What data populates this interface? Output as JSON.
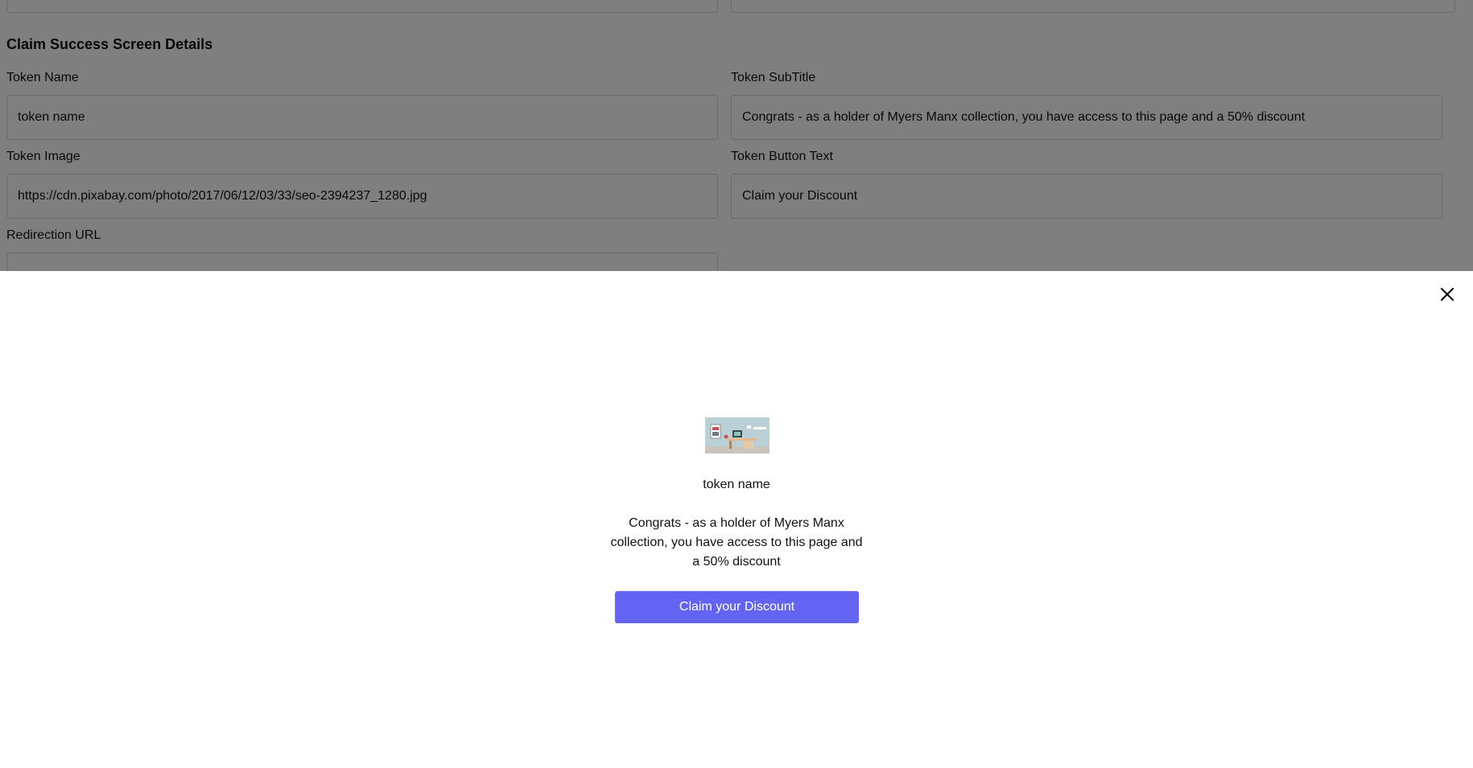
{
  "form": {
    "section_title": "Claim Success Screen Details",
    "token_name_label": "Token Name",
    "token_name_value": "token name",
    "token_subtitle_label": "Token SubTitle",
    "token_subtitle_value": "Congrats - as a holder of Myers Manx collection, you have access to this page and a 50% discount",
    "token_image_label": "Token Image",
    "token_image_value": "https://cdn.pixabay.com/photo/2017/06/12/03/33/seo-2394237_1280.jpg",
    "token_button_text_label": "Token Button Text",
    "token_button_text_value": "Claim your Discount",
    "redirection_url_label": "Redirection URL"
  },
  "modal": {
    "close_icon": "close-icon",
    "token_name": "token name",
    "token_subtitle": "Congrats - as a holder of Myers Manx collection, you have access to this page and a 50% discount",
    "button_label": "Claim your Discount",
    "button_color": "#6464f2"
  }
}
